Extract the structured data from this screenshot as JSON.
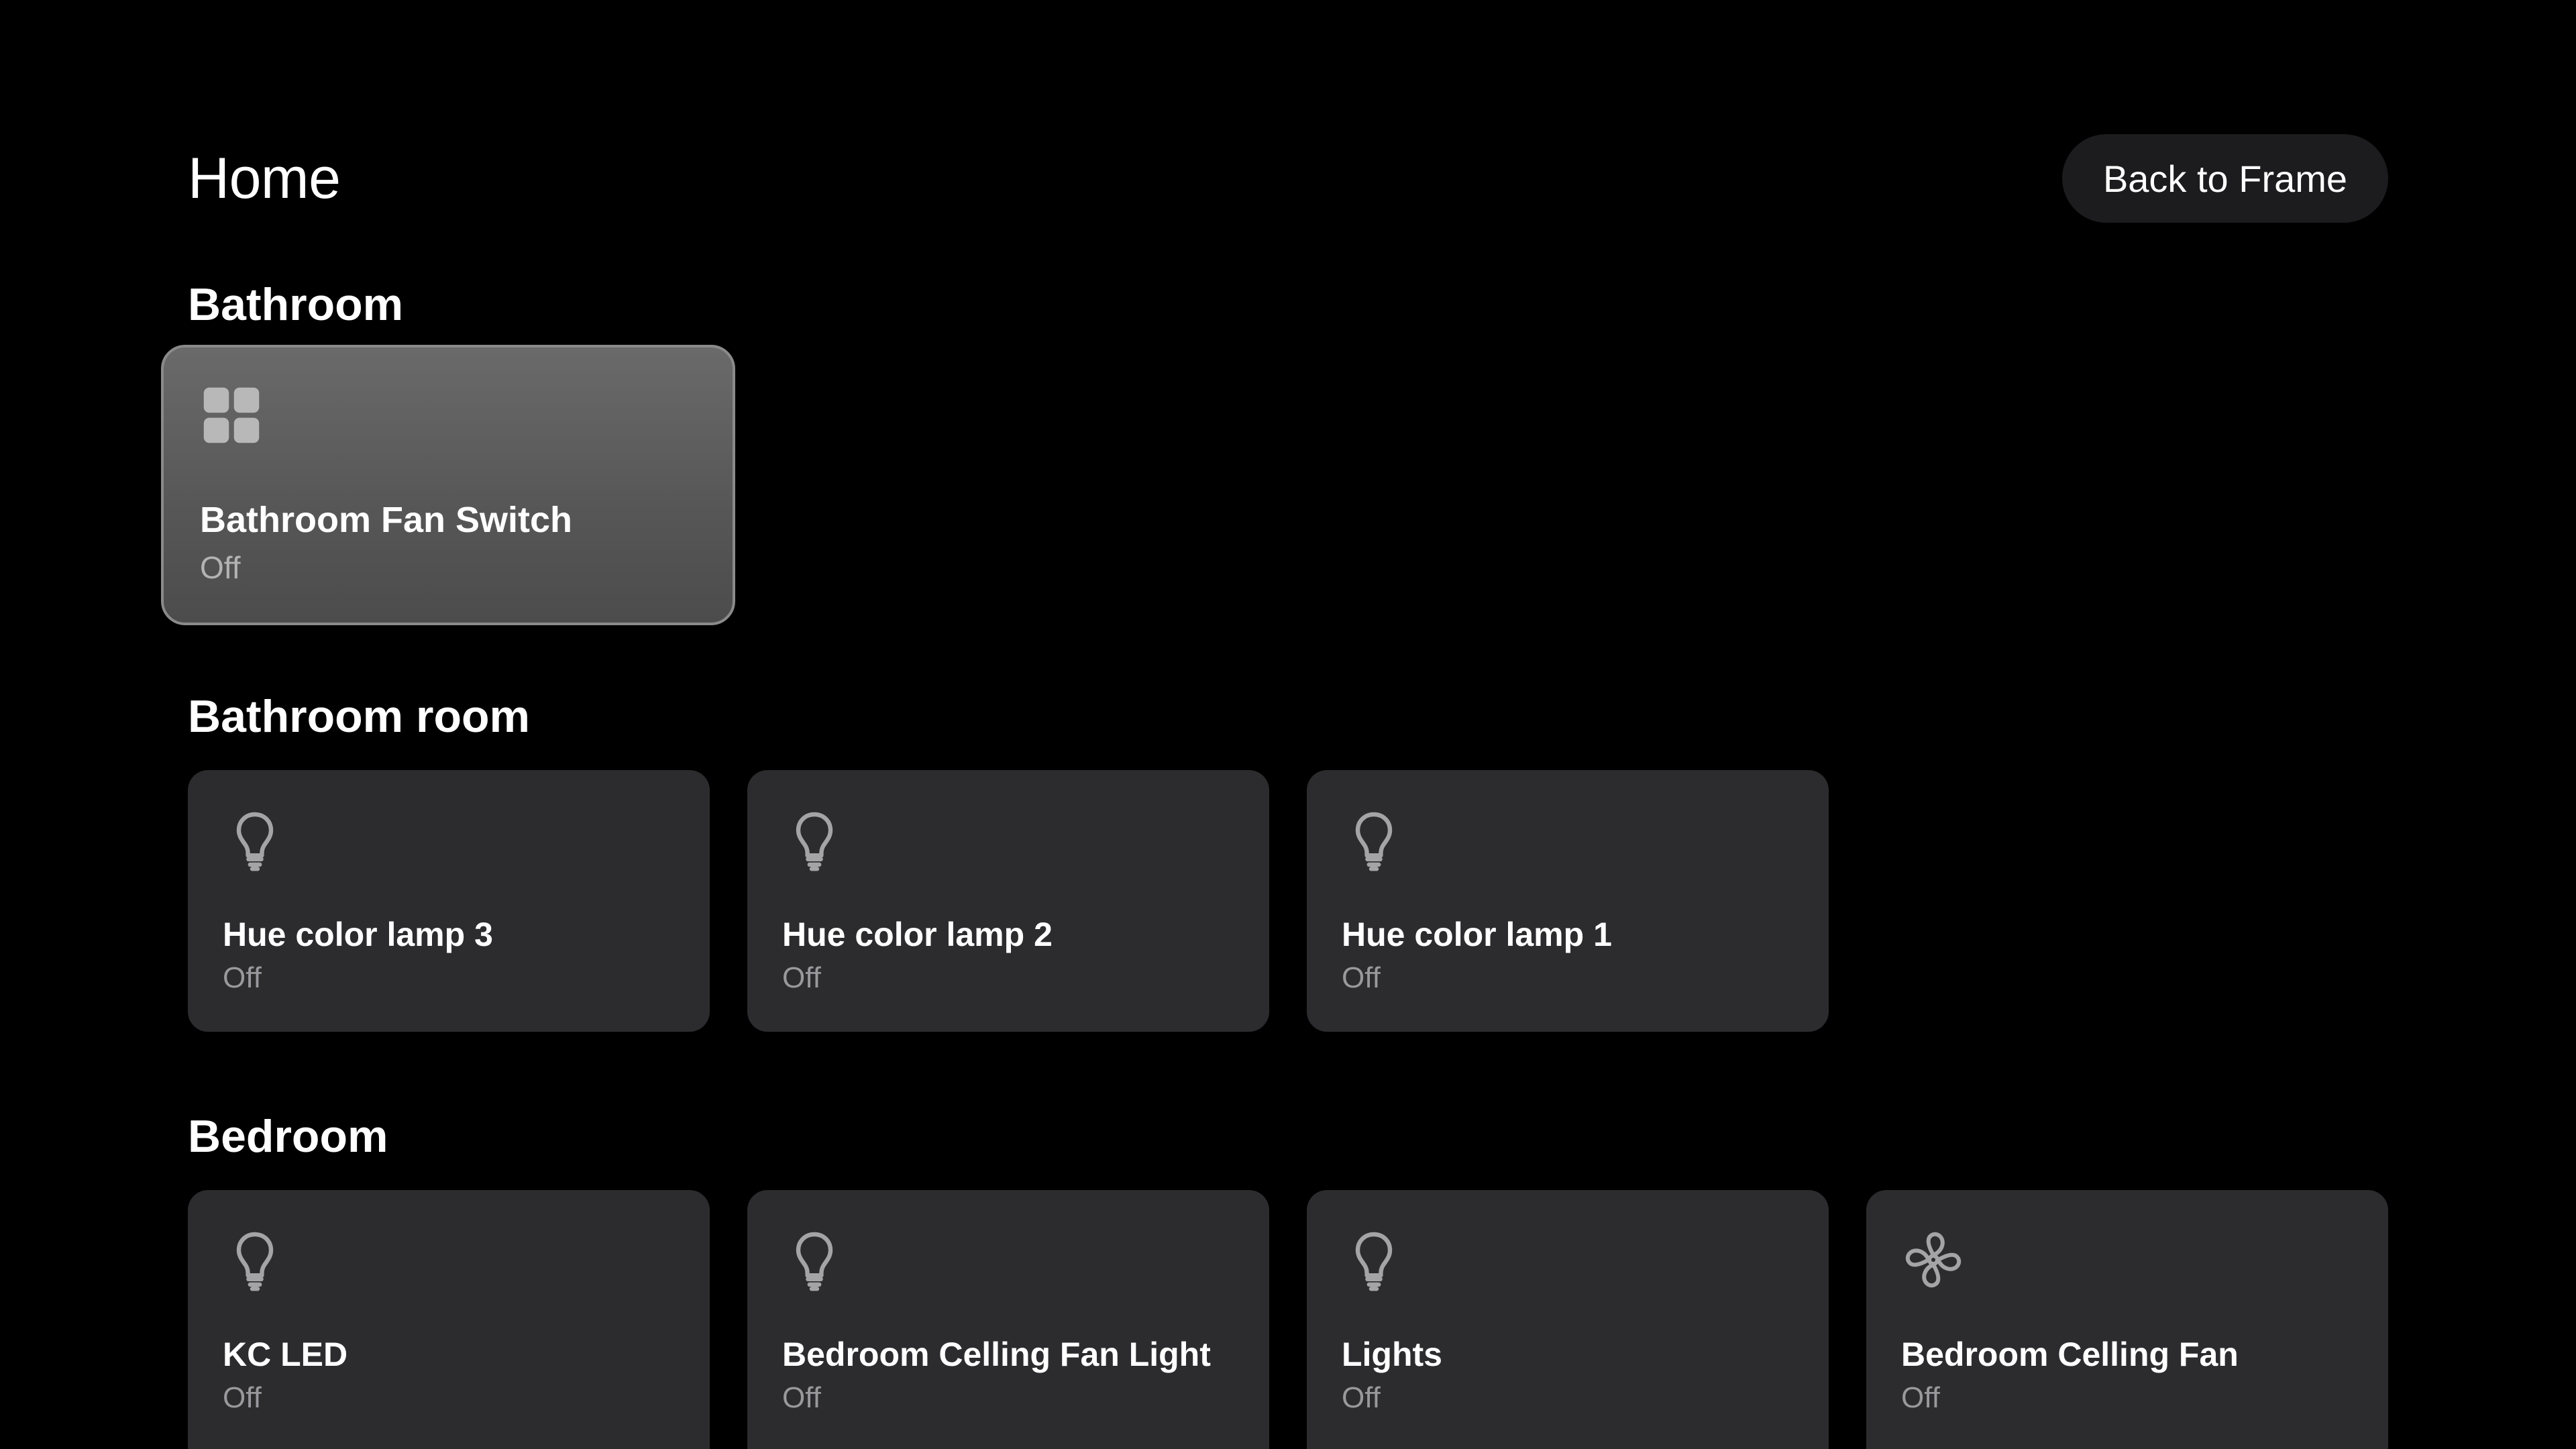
{
  "header": {
    "title": "Home",
    "back_button_label": "Back to Frame"
  },
  "sections": [
    {
      "title": "Bathroom",
      "devices": [
        {
          "name": "Bathroom Fan Switch",
          "status": "Off",
          "icon": "grid-switch-icon",
          "focused": true
        }
      ]
    },
    {
      "title": "Bathroom room",
      "devices": [
        {
          "name": "Hue color lamp 3",
          "status": "Off",
          "icon": "lightbulb-icon"
        },
        {
          "name": "Hue color lamp 2",
          "status": "Off",
          "icon": "lightbulb-icon"
        },
        {
          "name": "Hue color lamp 1",
          "status": "Off",
          "icon": "lightbulb-icon"
        }
      ]
    },
    {
      "title": "Bedroom",
      "devices": [
        {
          "name": "KC LED",
          "status": "Off",
          "icon": "lightbulb-icon"
        },
        {
          "name": "Bedroom Celling Fan Light",
          "status": "Off",
          "icon": "lightbulb-icon"
        },
        {
          "name": "Lights",
          "status": "Off",
          "icon": "lightbulb-icon"
        },
        {
          "name": "Bedroom Celling Fan",
          "status": "Off",
          "icon": "fan-icon"
        }
      ]
    }
  ],
  "colors": {
    "background": "#000000",
    "card": "#2c2c2e",
    "card_focused": "#5a5a5a",
    "text_primary": "#ffffff",
    "text_secondary": "#98989d",
    "button_background": "#1c1c1e"
  }
}
